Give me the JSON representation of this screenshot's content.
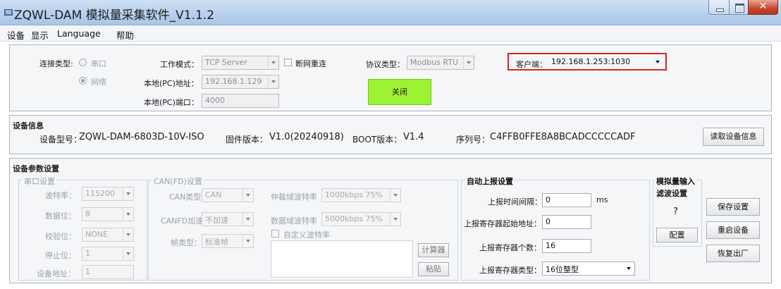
{
  "window": {
    "title": "ZQWL-DAM 模拟量采集软件_V1.1.2"
  },
  "menu": {
    "items": [
      "设备",
      "显示",
      "Language",
      "帮助"
    ]
  },
  "connection": {
    "type_label": "连接类型:",
    "radio_serial": "串口",
    "radio_network": "网络",
    "work_mode_label": "工作模式：",
    "work_mode_value": "TCP Server",
    "reconnect_label": "断网重连",
    "local_ip_label": "本地(PC)地址：",
    "local_ip_value": "192.168.1.129",
    "local_port_label": "本地(PC)端口：",
    "local_port_value": "4000",
    "protocol_label": "协议类型：",
    "protocol_value": "Modbus RTU",
    "close_button": "关闭",
    "client_label": "客户端：",
    "client_value": "192.168.1.253:1030"
  },
  "device_info": {
    "title": "设备信息",
    "model_label": "设备型号：",
    "model_value": "ZQWL-DAM-6803D-10V-ISO",
    "firmware_label": "固件版本：",
    "firmware_value": "V1.0(20240918)",
    "boot_label": "BOOT版本：",
    "boot_value": "V1.4",
    "serial_label": "序列号：",
    "serial_value": "C4FFB0FFE8A8BCADCCCCCADF",
    "read_button": "读取设备信息"
  },
  "params": {
    "title": "设备参数设置",
    "serial": {
      "title": "串口设置",
      "baud_label": "波特率：",
      "baud_value": "115200",
      "databits_label": "数据位：",
      "databits_value": "8",
      "parity_label": "校验位：",
      "parity_value": "NONE",
      "stopbits_label": "停止位：",
      "stopbits_value": "1",
      "addr_label": "设备地址：",
      "addr_value": "1"
    },
    "can": {
      "title": "CAN(FD)设置",
      "type_label": "CAN类型：",
      "type_value": "CAN",
      "accel_label": "CANFD加速：",
      "accel_value": "不加速",
      "frame_label": "帧类型：",
      "frame_value": "标准帧",
      "arb_label": "仲裁域波特率",
      "arb_value": "1000kbps 75%",
      "data_label": "数据域波特率",
      "data_value": "5000kbps 75%",
      "custom_label": "自定义波特率",
      "calc_button": "计算器",
      "paste_button": "粘贴"
    },
    "report": {
      "title": "自动上报设置",
      "interval_label": "上报时间间隔：",
      "interval_value": "0",
      "interval_unit": "ms",
      "start_label": "上报寄存器起始地址：",
      "start_value": "0",
      "count_label": "上报寄存器个数：",
      "count_value": "16",
      "type_label": "上报寄存器类型：",
      "type_value": "16位整型"
    },
    "filter": {
      "title_line1": "模拟量输入",
      "title_line2": "滤波设置",
      "value": "?",
      "config_button": "配置"
    },
    "buttons": {
      "save": "保存设置",
      "restart": "重启设备",
      "factory": "恢复出厂"
    }
  },
  "colors": {
    "close_button_bg": "#9cf233",
    "highlight_border": "#e02020",
    "title_gradient": "#bcd3ee"
  }
}
